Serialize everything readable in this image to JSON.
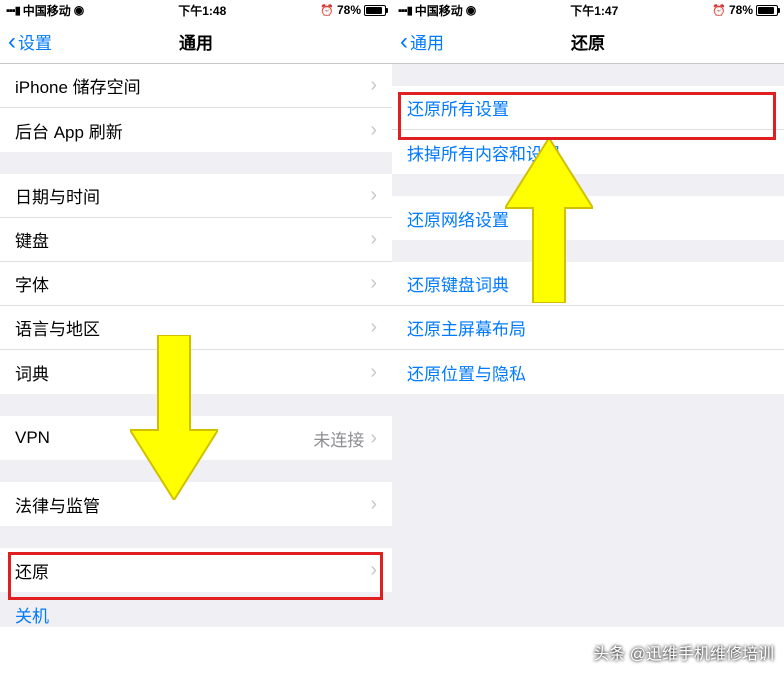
{
  "left": {
    "status": {
      "carrier": "中国移动",
      "time": "下午1:48",
      "battery": "78%"
    },
    "nav": {
      "back": "设置",
      "title": "通用"
    },
    "sec1": {
      "storage": "iPhone 储存空间",
      "bgrefresh": "后台 App 刷新"
    },
    "sec2": {
      "datetime": "日期与时间",
      "keyboard": "键盘",
      "fonts": "字体",
      "lang": "语言与地区",
      "dict": "词典"
    },
    "sec3": {
      "vpn": "VPN",
      "vpn_status": "未连接"
    },
    "sec4": {
      "legal": "法律与监管"
    },
    "sec5": {
      "reset": "还原"
    },
    "shutdown": "关机"
  },
  "right": {
    "status": {
      "carrier": "中国移动",
      "time": "下午1:47",
      "battery": "78%"
    },
    "nav": {
      "back": "通用",
      "title": "还原"
    },
    "sec1": {
      "reset_all": "还原所有设置",
      "erase_all": "抹掉所有内容和设置"
    },
    "sec2": {
      "reset_net": "还原网络设置"
    },
    "sec3": {
      "reset_kb": "还原键盘词典",
      "reset_home": "还原主屏幕布局",
      "reset_priv": "还原位置与隐私"
    }
  },
  "watermark": "头条 @迅维手机维修培训"
}
